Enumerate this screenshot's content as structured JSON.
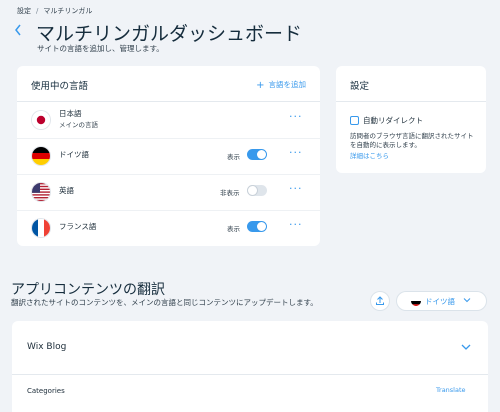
{
  "breadcrumb": {
    "items": [
      "設定",
      "マルチリンガル"
    ]
  },
  "header": {
    "title": "マルチリンガルダッシュボード",
    "subtitle": "サイトの言語を追加し、管理します。"
  },
  "languages_card": {
    "title": "使用中の言語",
    "add_label": "言語を追加",
    "rows": [
      {
        "name": "日本語",
        "sub": "メインの言語",
        "flag": "japan-flag-icon"
      },
      {
        "name": "ドイツ語",
        "visibility": "表示",
        "visible": true,
        "flag": "germany-flag-icon"
      },
      {
        "name": "英語",
        "visibility": "非表示",
        "visible": false,
        "flag": "usa-flag-icon"
      },
      {
        "name": "フランス語",
        "visibility": "表示",
        "visible": true,
        "flag": "france-flag-icon"
      }
    ],
    "more_symbol": "···"
  },
  "settings_card": {
    "title": "設定",
    "auto_redirect_label": "自動リダイレクト",
    "auto_redirect_checked": false,
    "description": "訪問者のブラウザ言語に翻訳されたサイトを自動的に表示します。",
    "details_link": "詳細はこちら"
  },
  "translation_section": {
    "title": "アプリコンテンツの翻訳",
    "subtitle": "翻訳されたサイトのコンテンツを、メインの言語と同じコンテンツにアップデートします。",
    "selected_language": "ドイツ語",
    "app": {
      "name": "Wix Blog",
      "category": "Categories",
      "translate_label": "Translate"
    }
  },
  "colors": {
    "accent": "#3899ec",
    "background": "#f0f3f7",
    "toggle_off": "#dfe5eb"
  }
}
